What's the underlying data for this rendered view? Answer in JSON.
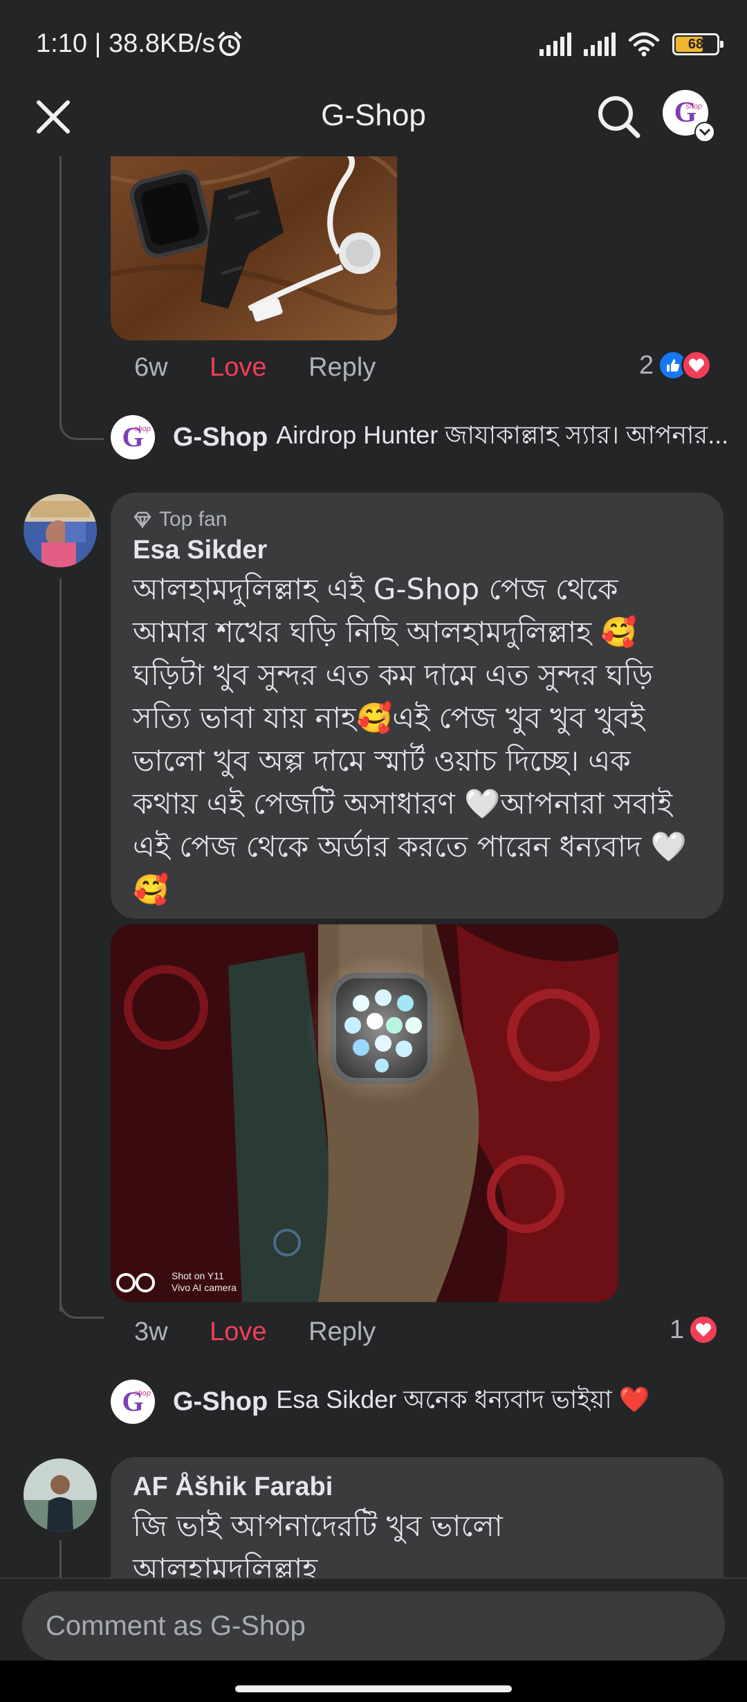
{
  "status_bar": {
    "time": "1:10 | 38.8KB/s",
    "battery_level": "68",
    "battery_fraction": 0.68
  },
  "header": {
    "title": "G-Shop"
  },
  "comment_1": {
    "age": "6w",
    "love_label": "Love",
    "reply_label": "Reply",
    "reaction_count": "2",
    "reply": {
      "author": "G-Shop",
      "text": "Airdrop Hunter জাযাকাল্লাহ স্যার। আপনার..."
    }
  },
  "comment_2": {
    "badge": "Top fan",
    "author": "Esa Sikder",
    "text": "আলহামদুলিল্লাহ এই G-Shop পেজ থেকে আমার শখের ঘড়ি নিছি আলহামদুলিল্লাহ 🥰 ঘড়িটা খুব সুন্দর এত কম দামে এত সুন্দর ঘড়ি সত্যি ভাবা যায় নাহ🥰এই পেজ খুব খুব খুবই ভালো খুব অল্প দামে স্মার্ট ওয়াচ দিচ্ছে। এক কথায় এই পেজটি অসাধারণ 🤍আপনারা সবাই এই পেজ থেকে অর্ডার করতে পারেন ধন্যবাদ 🤍🥰",
    "photo_watermark_line1": "Shot on Y11",
    "photo_watermark_line2": "Vivo AI camera",
    "age": "3w",
    "love_label": "Love",
    "reply_label": "Reply",
    "reaction_count": "1",
    "reply": {
      "author": "G-Shop",
      "text": "Esa Sikder অনেক ধন্যবাদ ভাইয়া ❤️"
    }
  },
  "comment_3": {
    "author": "AF Åšhik Farabi",
    "text": "জি ভাই আপনাদেরটি খুব ভালো আলহামদুলিল্লাহ"
  },
  "composer": {
    "placeholder": "Comment as G-Shop"
  },
  "colors": {
    "background": "#242526",
    "bubble": "#3a3b3c",
    "love": "#f33e58",
    "like": "#1877f2",
    "battery": "#f2b531"
  }
}
